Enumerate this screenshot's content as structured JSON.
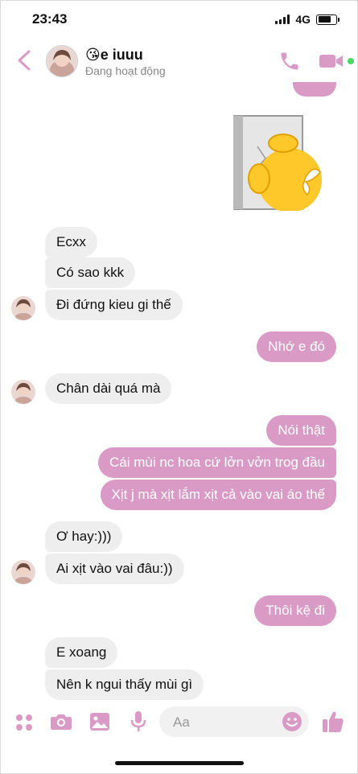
{
  "status_bar": {
    "time": "23:43",
    "network": "4G"
  },
  "header": {
    "contact_name": "😘e iuuu",
    "contact_status": "Đang hoạt động"
  },
  "messages": [
    {
      "text": "Ecxx",
      "dir": "in"
    },
    {
      "text": "Có sao kkk",
      "dir": "in"
    },
    {
      "text": "Đi đứng kieu gi thế",
      "dir": "in"
    },
    {
      "text": "Nhớ e đó",
      "dir": "out"
    },
    {
      "text": "Chân dài quá mà",
      "dir": "in"
    },
    {
      "text": "Nói thật",
      "dir": "out"
    },
    {
      "text": "Cái mùi nc hoa cứ lởn vởn trog đầu",
      "dir": "out"
    },
    {
      "text": "Xịt j mà xịt lắm xịt cả vào vai áo thế",
      "dir": "out"
    },
    {
      "text": "Ơ hay:)))",
      "dir": "in"
    },
    {
      "text": "Ai xịt vào vai đâu:))",
      "dir": "in"
    },
    {
      "text": "Thôi kệ đi",
      "dir": "out"
    },
    {
      "text": "E xoang",
      "dir": "in"
    },
    {
      "text": "Nên k ngui thấy mùi gì",
      "dir": "in"
    }
  ],
  "composer": {
    "placeholder": "Aa"
  },
  "colors": {
    "accent": "#d99bc6",
    "incoming_bubble": "#eeeeee",
    "online": "#4cd964"
  },
  "icons": [
    "back-chevron-icon",
    "phone-icon",
    "video-camera-icon",
    "menu-dots-icon",
    "camera-icon",
    "image-icon",
    "microphone-icon",
    "emoji-icon",
    "thumbs-up-icon"
  ]
}
